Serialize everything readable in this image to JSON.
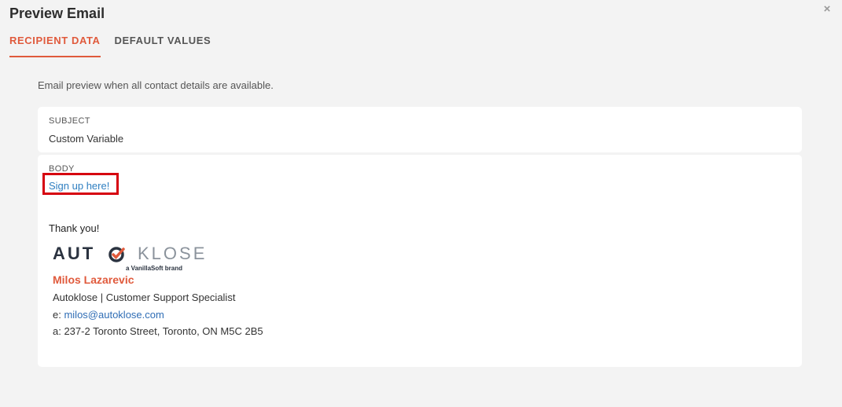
{
  "modal": {
    "title": "Preview Email",
    "close_glyph": "×"
  },
  "tabs": [
    {
      "label": "RECIPIENT DATA",
      "active": true
    },
    {
      "label": "DEFAULT VALUES",
      "active": false
    }
  ],
  "info_text": "Email preview when all contact details are available.",
  "subject": {
    "label": "SUBJECT",
    "value": "Custom Variable"
  },
  "body": {
    "label": "BODY",
    "link_text": "Sign up here!",
    "thanks": "Thank you!",
    "logo": {
      "word_dark": "AUT",
      "word_light": "KLOSE",
      "tagline": "a VanillaSoft brand"
    },
    "signature": {
      "name": "Milos Lazarevic",
      "role": "Autoklose | Customer Support Specialist",
      "email_prefix": "e: ",
      "email": "milos@autoklose.com",
      "address": "a: 237-2 Toronto Street, Toronto, ON M5C 2B5"
    }
  },
  "colors": {
    "accent": "#e05a3c",
    "link": "#2f7fc1",
    "highlight_border": "#d6000f",
    "background": "#f3f3f3"
  }
}
